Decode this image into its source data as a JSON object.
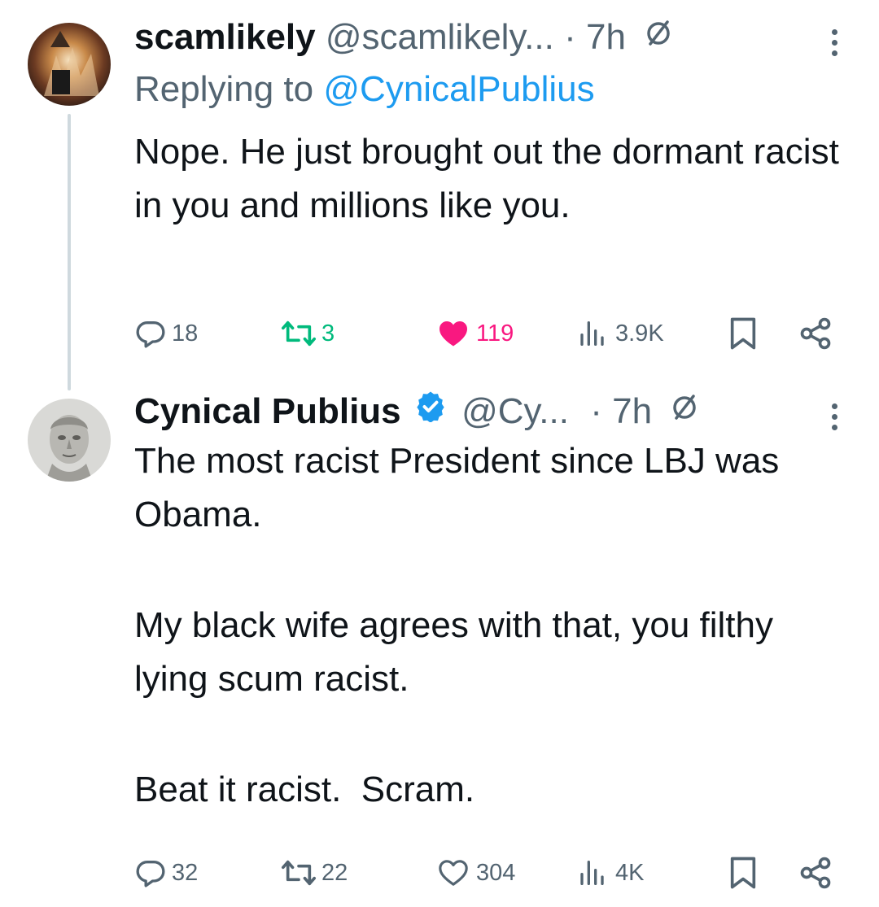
{
  "colors": {
    "text": "#0f1419",
    "secondary": "#536471",
    "link": "#1d9bf0",
    "retweet_green": "#00ba7c",
    "like_pink": "#f91880",
    "thread_line": "#cfd9de"
  },
  "tweets": [
    {
      "display_name": "scamlikely",
      "handle": "@scamlikely...",
      "separator": "·",
      "time": "7h",
      "replying_label": "Replying to",
      "replying_handle": "@CynicalPublius",
      "body": [
        "Nope. He just brought out the dormant racist in you and millions like you."
      ],
      "stats": {
        "replies": "18",
        "retweets": "3",
        "likes": "119",
        "views": "3.9K"
      },
      "liked": true,
      "icons": [
        "reply-icon",
        "retweet-icon",
        "heart-filled-icon",
        "views-icon",
        "bookmark-icon",
        "share-icon",
        "globe-slash-icon",
        "more-vertical-icon"
      ]
    },
    {
      "display_name": "Cynical Publius",
      "verified": true,
      "handle": "@Cy...",
      "separator": "·",
      "time": "7h",
      "body": [
        "The most racist President since LBJ was Obama.",
        "My black wife agrees with that, you filthy lying scum racist.",
        "Beat it racist.  Scram."
      ],
      "stats": {
        "replies": "32",
        "retweets": "22",
        "likes": "304",
        "views": "4K"
      },
      "liked": false,
      "icons": [
        "reply-icon",
        "retweet-icon",
        "heart-outline-icon",
        "views-icon",
        "bookmark-icon",
        "share-icon",
        "verified-badge-icon",
        "globe-slash-icon",
        "more-vertical-icon"
      ]
    }
  ]
}
